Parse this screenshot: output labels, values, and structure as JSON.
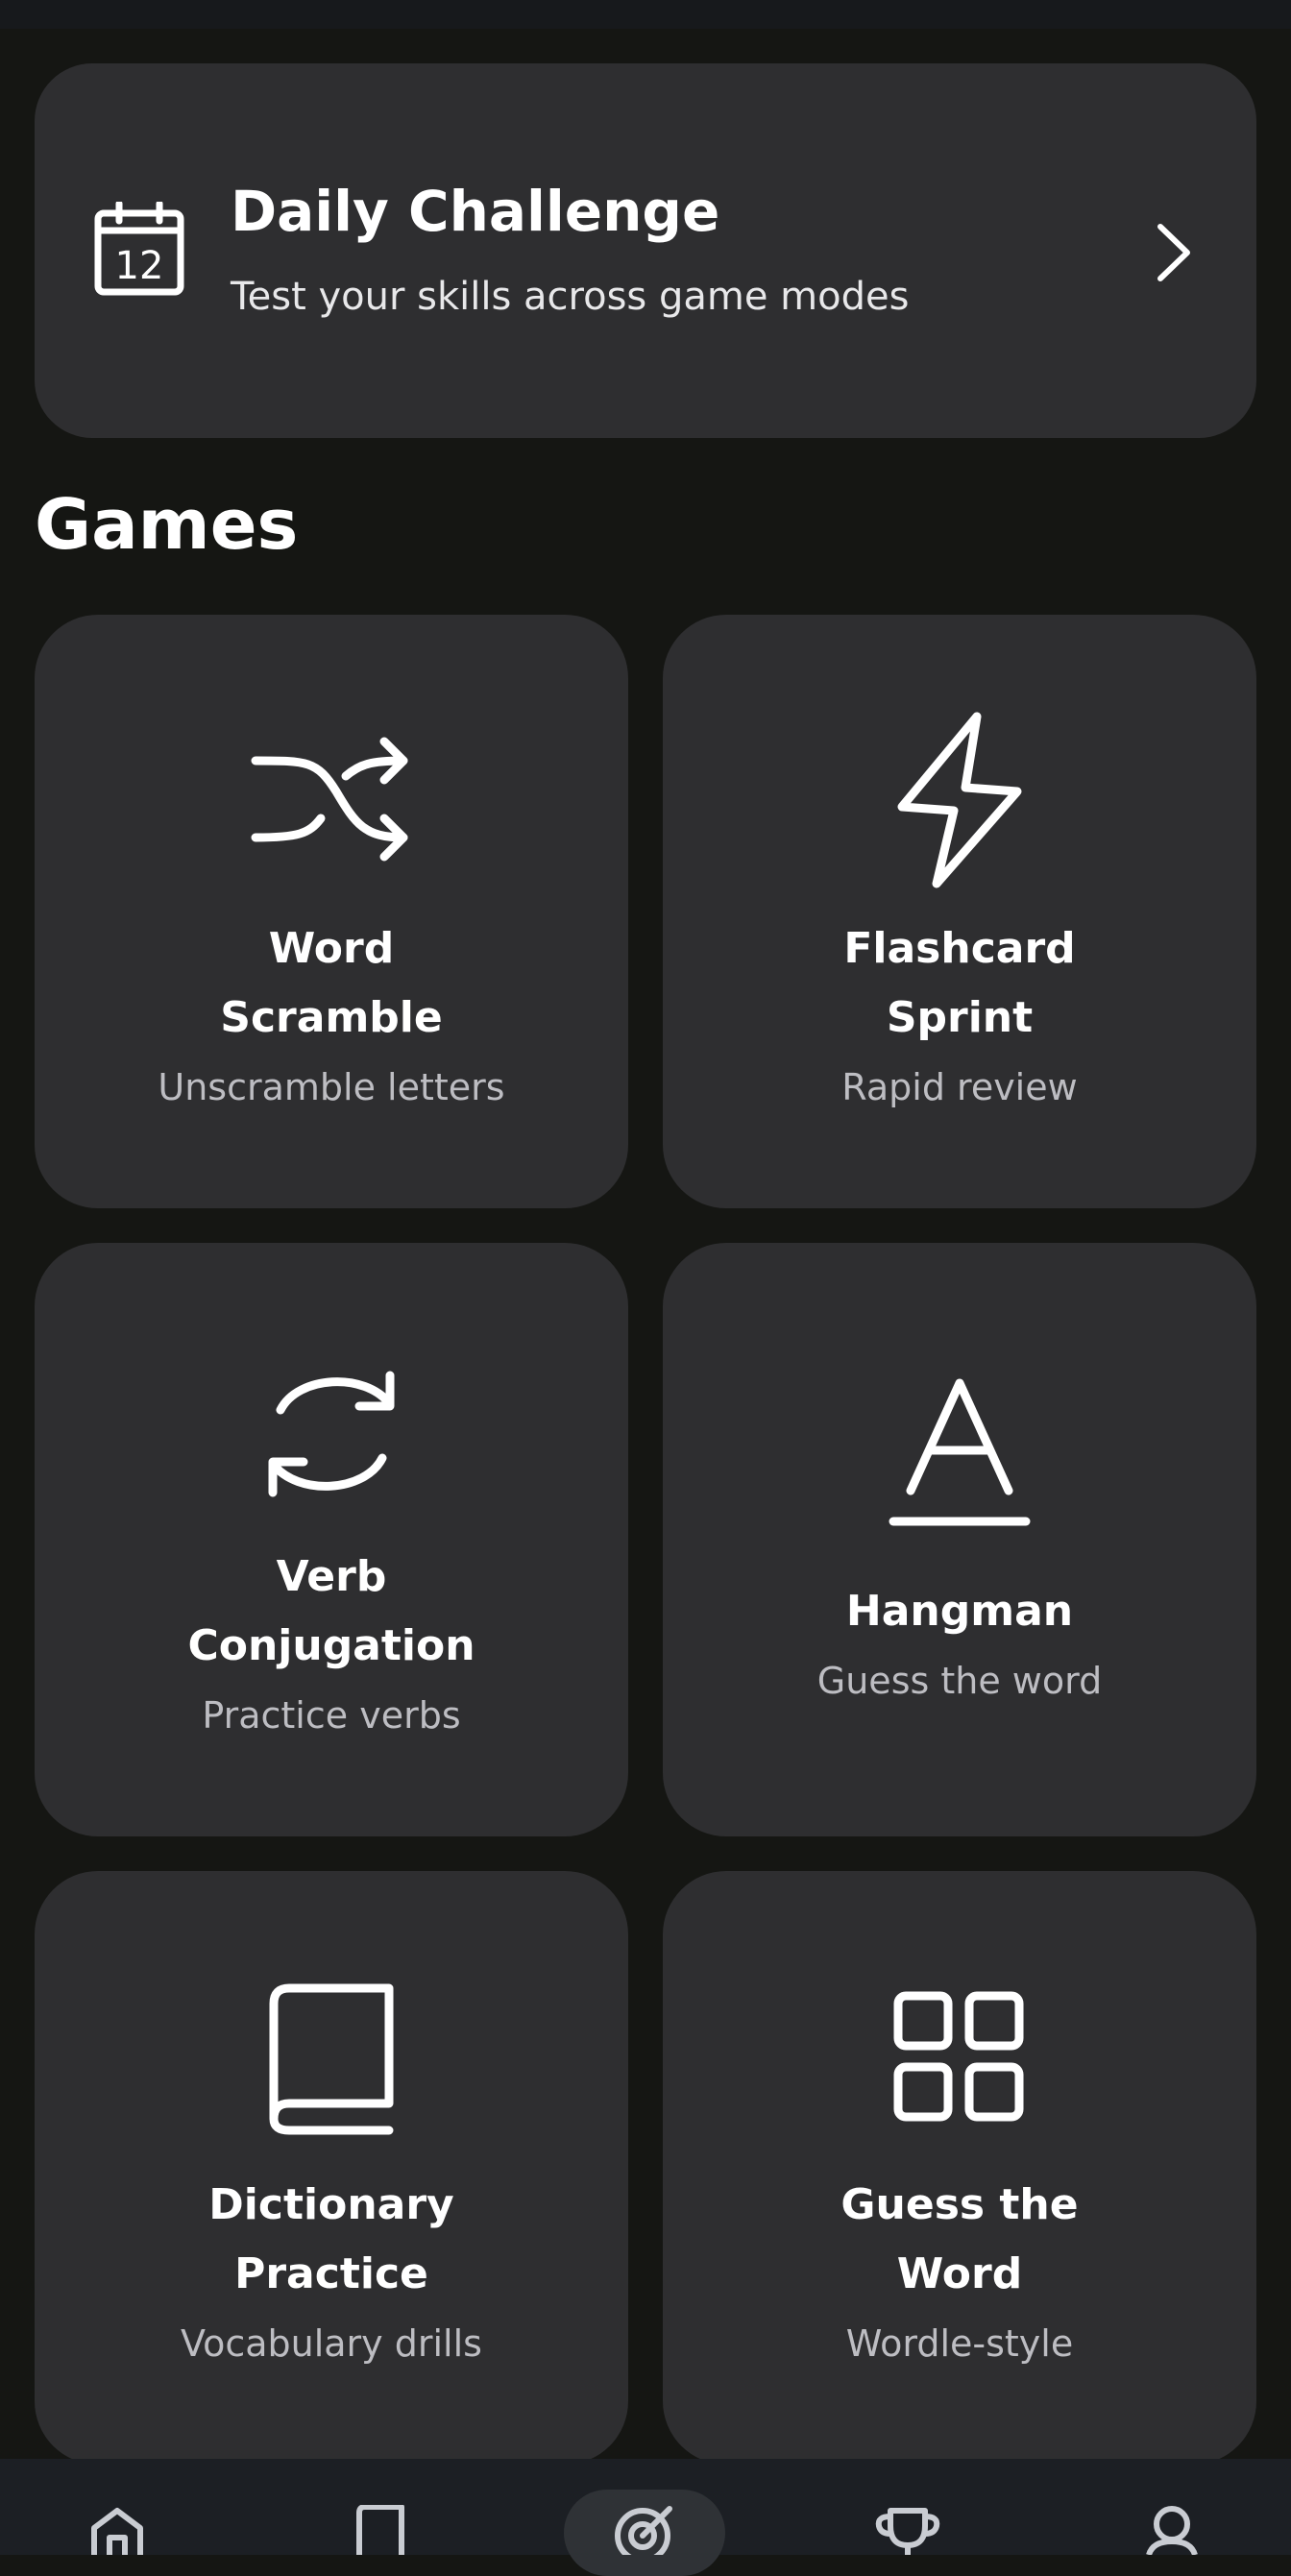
{
  "challenge": {
    "title": "Daily Challenge",
    "subtitle": "Test your skills across game modes",
    "calendar_day": "12",
    "icon": "calendar-icon"
  },
  "games_section": {
    "title": "Games"
  },
  "games": [
    {
      "title_line1": "Word",
      "title_line2": "Scramble",
      "subtitle": "Unscramble letters",
      "icon": "shuffle-icon"
    },
    {
      "title_line1": "Flashcard",
      "title_line2": "Sprint",
      "subtitle": "Rapid review",
      "icon": "lightning-icon"
    },
    {
      "title_line1": "Verb",
      "title_line2": "Conjugation",
      "subtitle": "Practice verbs",
      "icon": "refresh-icon"
    },
    {
      "title_line1": "Hangman",
      "title_line2": "",
      "subtitle": "Guess the word",
      "icon": "letter-a-icon"
    },
    {
      "title_line1": "Dictionary",
      "title_line2": "Practice",
      "subtitle": "Vocabulary drills",
      "icon": "book-icon"
    },
    {
      "title_line1": "Guess the",
      "title_line2": "Word",
      "subtitle": "Wordle-style",
      "icon": "grid-icon"
    }
  ],
  "nav": {
    "items": [
      "home-icon",
      "book-icon",
      "target-icon",
      "trophy-icon",
      "profile-icon"
    ],
    "active_index": 2
  },
  "colors": {
    "background": "#151613",
    "card": "#2e2e30",
    "nav_bar": "#1c1f24",
    "subtitle_text": "#bdbdc2"
  }
}
